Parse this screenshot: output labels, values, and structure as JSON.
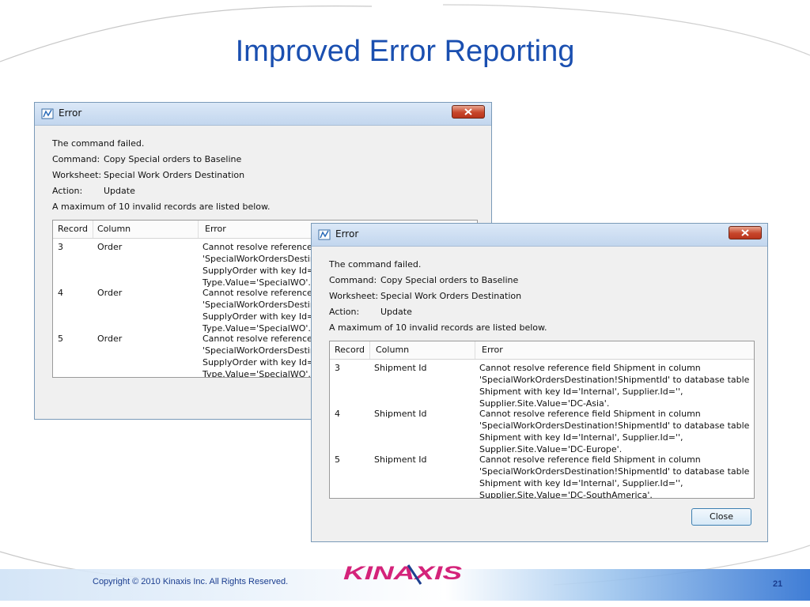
{
  "slide": {
    "title": "Improved Error Reporting",
    "copyright": "Copyright © 2010 Kinaxis Inc. All Rights Reserved.",
    "page_number": "21",
    "logo_text": "KINAXIS"
  },
  "dialog_back": {
    "title": "Error",
    "message": "The command failed.",
    "command_label": "Command:",
    "command_value": "Copy Special orders to Baseline",
    "worksheet_label": "Worksheet:",
    "worksheet_value": "Special Work Orders Destination",
    "action_label": "Action:",
    "action_value": "Update",
    "note": "A maximum of 10 invalid records are listed below.",
    "columns": [
      "Record",
      "Column",
      "Error"
    ],
    "rows": [
      {
        "record": "3",
        "column": "Order",
        "error": [
          "Cannot resolve reference f",
          "'SpecialWorkOrdersDestina",
          "SupplyOrder with key Id='',",
          "Type.Value='SpecialWO'. T"
        ]
      },
      {
        "record": "4",
        "column": "Order",
        "error": [
          "Cannot resolve reference f",
          "'SpecialWorkOrdersDestina",
          "SupplyOrder with key Id='',",
          "Type.Value='SpecialWO'. T"
        ]
      },
      {
        "record": "5",
        "column": "Order",
        "error": [
          "Cannot resolve reference f",
          "'SpecialWorkOrdersDestina",
          "SupplyOrder with key Id='',",
          "Type.Value='SpecialWO'. T"
        ]
      }
    ]
  },
  "dialog_front": {
    "title": "Error",
    "message": "The command failed.",
    "command_label": "Command:",
    "command_value": "Copy Special orders to Baseline",
    "worksheet_label": "Worksheet:",
    "worksheet_value": "Special Work Orders Destination",
    "action_label": "Action:",
    "action_value": "Update",
    "note": "A maximum of 10 invalid records are listed below.",
    "columns": [
      "Record",
      "Column",
      "Error"
    ],
    "rows": [
      {
        "record": "3",
        "column": "Shipment Id",
        "error": [
          "Cannot resolve reference field Shipment in column",
          "'SpecialWorkOrdersDestination!ShipmentId' to database table",
          "Shipment with key Id='Internal', Supplier.Id='',",
          "Supplier.Site.Value='DC-Asia'."
        ]
      },
      {
        "record": "4",
        "column": "Shipment Id",
        "error": [
          "Cannot resolve reference field Shipment in column",
          "'SpecialWorkOrdersDestination!ShipmentId' to database table",
          "Shipment with key Id='Internal', Supplier.Id='',",
          "Supplier.Site.Value='DC-Europe'."
        ]
      },
      {
        "record": "5",
        "column": "Shipment Id",
        "error": [
          "Cannot resolve reference field Shipment in column",
          "'SpecialWorkOrdersDestination!ShipmentId' to database table",
          "Shipment with key Id='Internal', Supplier.Id='',",
          "Supplier.Site.Value='DC-SouthAmerica'."
        ]
      }
    ],
    "close_button": "Close"
  },
  "colors": {
    "title_blue": "#1a4fb0",
    "footer_blue": "#1a3d8f",
    "logo_pink": "#d4237a",
    "logo_blue": "#1d3f8f"
  }
}
